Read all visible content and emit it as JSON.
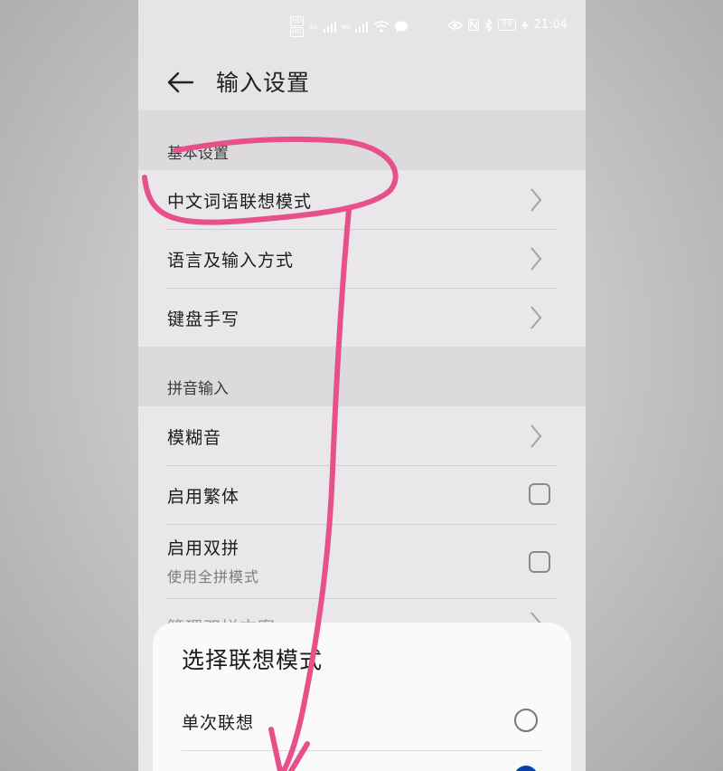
{
  "status_bar": {
    "hd1": "HD",
    "hd2": "HD",
    "net1": "4G",
    "net2": "4G",
    "battery": "89",
    "time": "21:04",
    "icons": [
      "eye-icon",
      "nfc-icon",
      "bluetooth-icon",
      "battery-icon",
      "charging-icon"
    ]
  },
  "header": {
    "title": "输入设置",
    "back_icon": "arrow-left-icon"
  },
  "sections": [
    {
      "header": "基本设置",
      "items": [
        {
          "title": "中文词语联想模式",
          "control": "chevron"
        },
        {
          "title": "语言及输入方式",
          "control": "chevron"
        },
        {
          "title": "键盘手写",
          "control": "chevron"
        }
      ]
    },
    {
      "header": "拼音输入",
      "items": [
        {
          "title": "模糊音",
          "control": "chevron"
        },
        {
          "title": "启用繁体",
          "control": "checkbox",
          "checked": false
        },
        {
          "title": "启用双拼",
          "subtitle": "使用全拼模式",
          "control": "checkbox",
          "checked": false
        },
        {
          "title": "管理双拼方案",
          "control": "chevron"
        }
      ]
    }
  ],
  "sheet": {
    "title": "选择联想模式",
    "options": [
      {
        "label": "单次联想",
        "selected": false
      },
      {
        "label": "",
        "selected": true
      }
    ]
  },
  "colors": {
    "annotation": "#e8508a",
    "selected_radio": "#0a3fa6"
  }
}
